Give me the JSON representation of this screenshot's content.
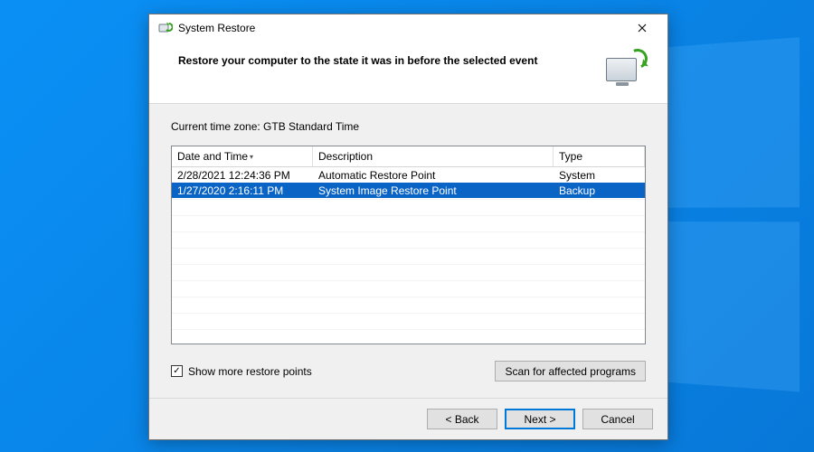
{
  "window": {
    "title": "System Restore"
  },
  "header": {
    "heading": "Restore your computer to the state it was in before the selected event"
  },
  "timezone_label": "Current time zone: GTB Standard Time",
  "columns": {
    "date_time": "Date and Time",
    "description": "Description",
    "type": "Type"
  },
  "restore_points": [
    {
      "datetime": "2/28/2021 12:24:36 PM",
      "description": "Automatic Restore Point",
      "type": "System",
      "selected": false
    },
    {
      "datetime": "1/27/2020 2:16:11 PM",
      "description": "System Image Restore Point",
      "type": "Backup",
      "selected": true
    }
  ],
  "show_more": {
    "label": "Show more restore points",
    "checked": true
  },
  "scan_button": "Scan for affected programs",
  "buttons": {
    "back": "< Back",
    "next": "Next >",
    "cancel": "Cancel"
  }
}
